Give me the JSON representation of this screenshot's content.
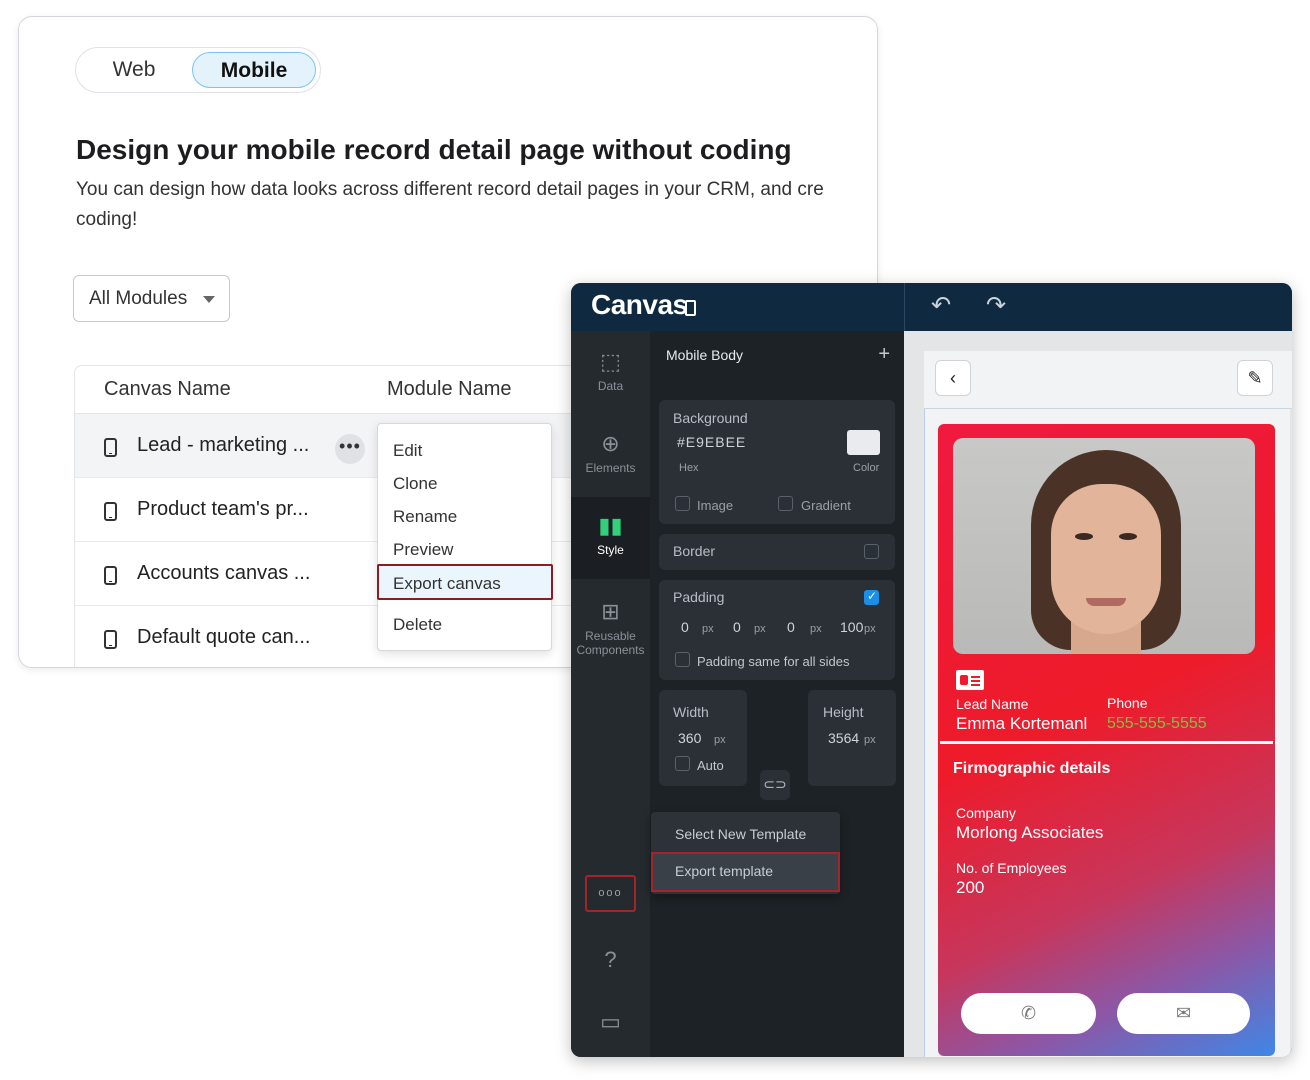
{
  "toggle": {
    "web": "Web",
    "mobile": "Mobile"
  },
  "heading": "Design your mobile record detail page without coding",
  "description": "You can design how data looks across different record detail pages in your CRM, and cre coding!",
  "modules": {
    "selected": "All Modules"
  },
  "table": {
    "headers": [
      "Canvas Name",
      "Module Name"
    ],
    "rows": [
      {
        "name": "Lead - marketing ..."
      },
      {
        "name": "Product team's pr..."
      },
      {
        "name": "Accounts canvas ..."
      },
      {
        "name": "Default quote can..."
      }
    ],
    "more_icon": "•••"
  },
  "context_menu": [
    "Edit",
    "Clone",
    "Rename",
    "Preview",
    "Export canvas",
    "Delete"
  ],
  "canvas": {
    "logo": "Canvas",
    "rail": [
      {
        "label": "Data",
        "icon": "data-select-icon"
      },
      {
        "label": "Elements",
        "icon": "add-circle-icon"
      },
      {
        "label": "Style",
        "icon": "style-icon"
      },
      {
        "label": "Reusable Components",
        "icon": "components-icon"
      }
    ],
    "more_dots": "ooo",
    "panel_title": "Mobile Body",
    "background": {
      "label": "Background",
      "hex": "#E9EBEE",
      "hex_label": "Hex",
      "color_label": "Color",
      "image": "Image",
      "gradient": "Gradient"
    },
    "border": {
      "label": "Border"
    },
    "padding": {
      "label": "Padding",
      "v1": "0",
      "v2": "0",
      "v3": "0",
      "v4": "100",
      "unit": "px",
      "same": "Padding same for all sides"
    },
    "width": {
      "label": "Width",
      "value": "360",
      "unit": "px",
      "auto": "Auto"
    },
    "height": {
      "label": "Height",
      "value": "3564",
      "unit": "px"
    },
    "template_menu": {
      "select": "Select New Template",
      "export": "Export template"
    }
  },
  "preview": {
    "lead_name_label": "Lead Name",
    "lead_name": "Emma Kortemanl",
    "phone_label": "Phone",
    "phone": "555-555-5555",
    "section": "Firmographic details",
    "company_label": "Company",
    "company": "Morlong Associates",
    "employees_label": "No. of Employees",
    "employees": "200"
  },
  "colors": {
    "accent": "#1b8ee8",
    "highlight": "#8c1c22",
    "topbar": "#0f2a40"
  }
}
